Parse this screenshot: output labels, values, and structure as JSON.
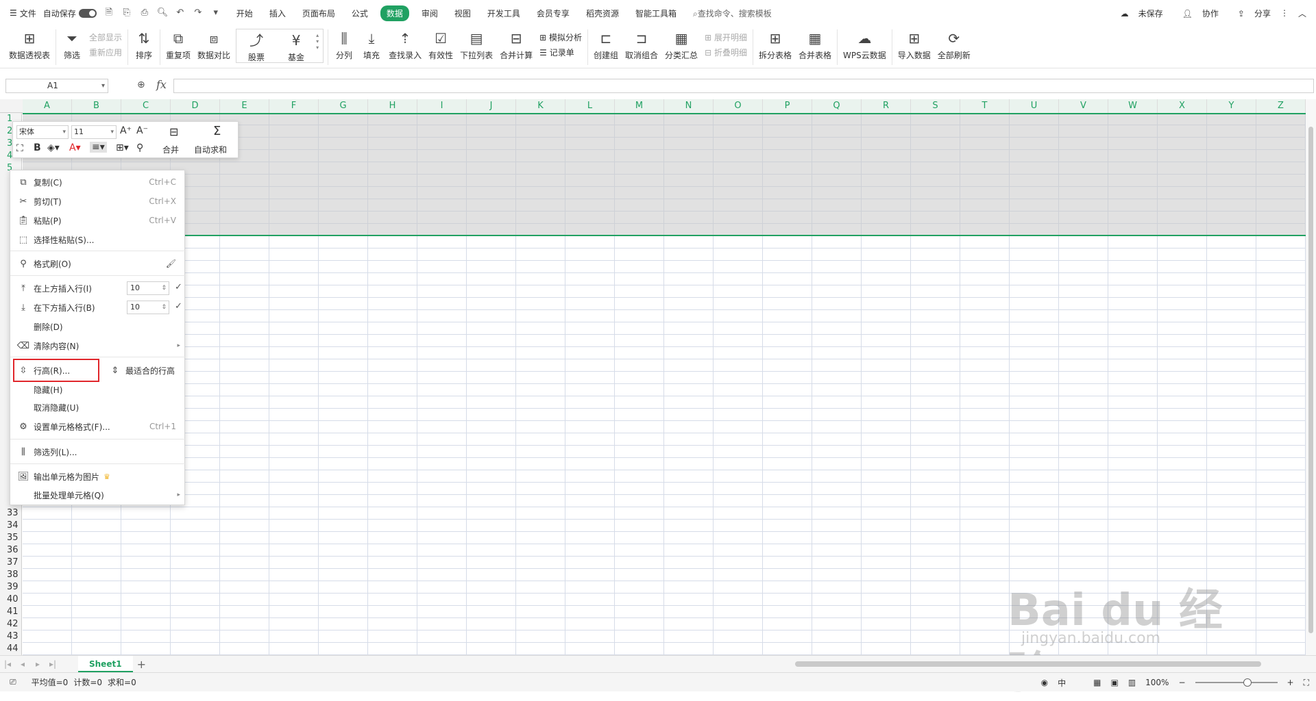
{
  "menubar": {
    "file": "文件",
    "autosave": "自动保存",
    "tabs": [
      "开始",
      "插入",
      "页面布局",
      "公式",
      "数据",
      "审阅",
      "视图",
      "开发工具",
      "会员专享",
      "稻壳资源",
      "智能工具箱"
    ],
    "active_tab": "数据",
    "search": "查找命令、搜索模板",
    "unsaved": "未保存",
    "collab": "协作",
    "share": "分享"
  },
  "ribbon": {
    "pivot": "数据透视表",
    "filter": "筛选",
    "show_all": "全部显示",
    "reapply": "重新应用",
    "sort": "排序",
    "duplicates": "重复项",
    "compare": "数据对比",
    "stock": "股票",
    "fund": "基金",
    "split": "分列",
    "fill": "填充",
    "lookup": "查找录入",
    "validity": "有效性",
    "dropdown": "下拉列表",
    "consolidate": "合并计算",
    "whatif": "模拟分析",
    "records": "记录单",
    "group": "创建组",
    "ungroup": "取消组合",
    "subtotal": "分类汇总",
    "expand": "展开明细",
    "collapse": "折叠明细",
    "split_table": "拆分表格",
    "merge_table": "合并表格",
    "wps_cloud": "WPS云数据",
    "import": "导入数据",
    "refresh_all": "全部刷新"
  },
  "formula_bar": {
    "namebox": "A1",
    "fx": "fx",
    "value": ""
  },
  "columns": [
    "A",
    "B",
    "C",
    "D",
    "E",
    "F",
    "G",
    "H",
    "I",
    "J",
    "K",
    "L",
    "M",
    "N",
    "O",
    "P",
    "Q",
    "R",
    "S",
    "T",
    "U",
    "V",
    "W",
    "X",
    "Y",
    "Z"
  ],
  "rows_visible": [
    "1",
    "2",
    "3",
    "4",
    "5",
    "",
    "",
    "",
    "",
    "",
    "",
    "",
    "",
    "",
    "",
    "",
    "",
    "",
    "",
    "",
    "",
    "",
    "",
    "",
    "",
    "",
    "",
    "",
    "",
    "",
    "",
    "",
    "33",
    "34",
    "35",
    "36",
    "37",
    "38",
    "39",
    "40",
    "41",
    "42",
    "43",
    "44"
  ],
  "mini_toolbar": {
    "font": "宋体",
    "size": "11",
    "merge": "合并",
    "autosum": "自动求和"
  },
  "context_menu": {
    "copy": "复制(C)",
    "copy_sc": "Ctrl+C",
    "cut": "剪切(T)",
    "cut_sc": "Ctrl+X",
    "paste": "粘贴(P)",
    "paste_sc": "Ctrl+V",
    "paste_special": "选择性粘贴(S)...",
    "format_painter": "格式刷(O)",
    "insert_above": "在上方插入行(I)",
    "insert_above_val": "10",
    "insert_below": "在下方插入行(B)",
    "insert_below_val": "10",
    "delete": "删除(D)",
    "clear": "清除内容(N)",
    "row_height": "行高(R)...",
    "best_fit": "最适合的行高",
    "hide": "隐藏(H)",
    "unhide": "取消隐藏(U)",
    "format_cells": "设置单元格格式(F)...",
    "format_cells_sc": "Ctrl+1",
    "filter_cols": "筛选列(L)...",
    "export_image": "输出单元格为图片",
    "batch": "批量处理单元格(Q)"
  },
  "sheets": {
    "active": "Sheet1"
  },
  "status": {
    "avg": "平均值=0",
    "count": "计数=0",
    "sum": "求和=0",
    "zoom": "100%",
    "lang": "中"
  },
  "watermark": {
    "main": "Bai du 经验",
    "sub": "jingyan.baidu.com"
  },
  "colors": {
    "accent": "#20a162",
    "highlight": "#e0262b"
  }
}
